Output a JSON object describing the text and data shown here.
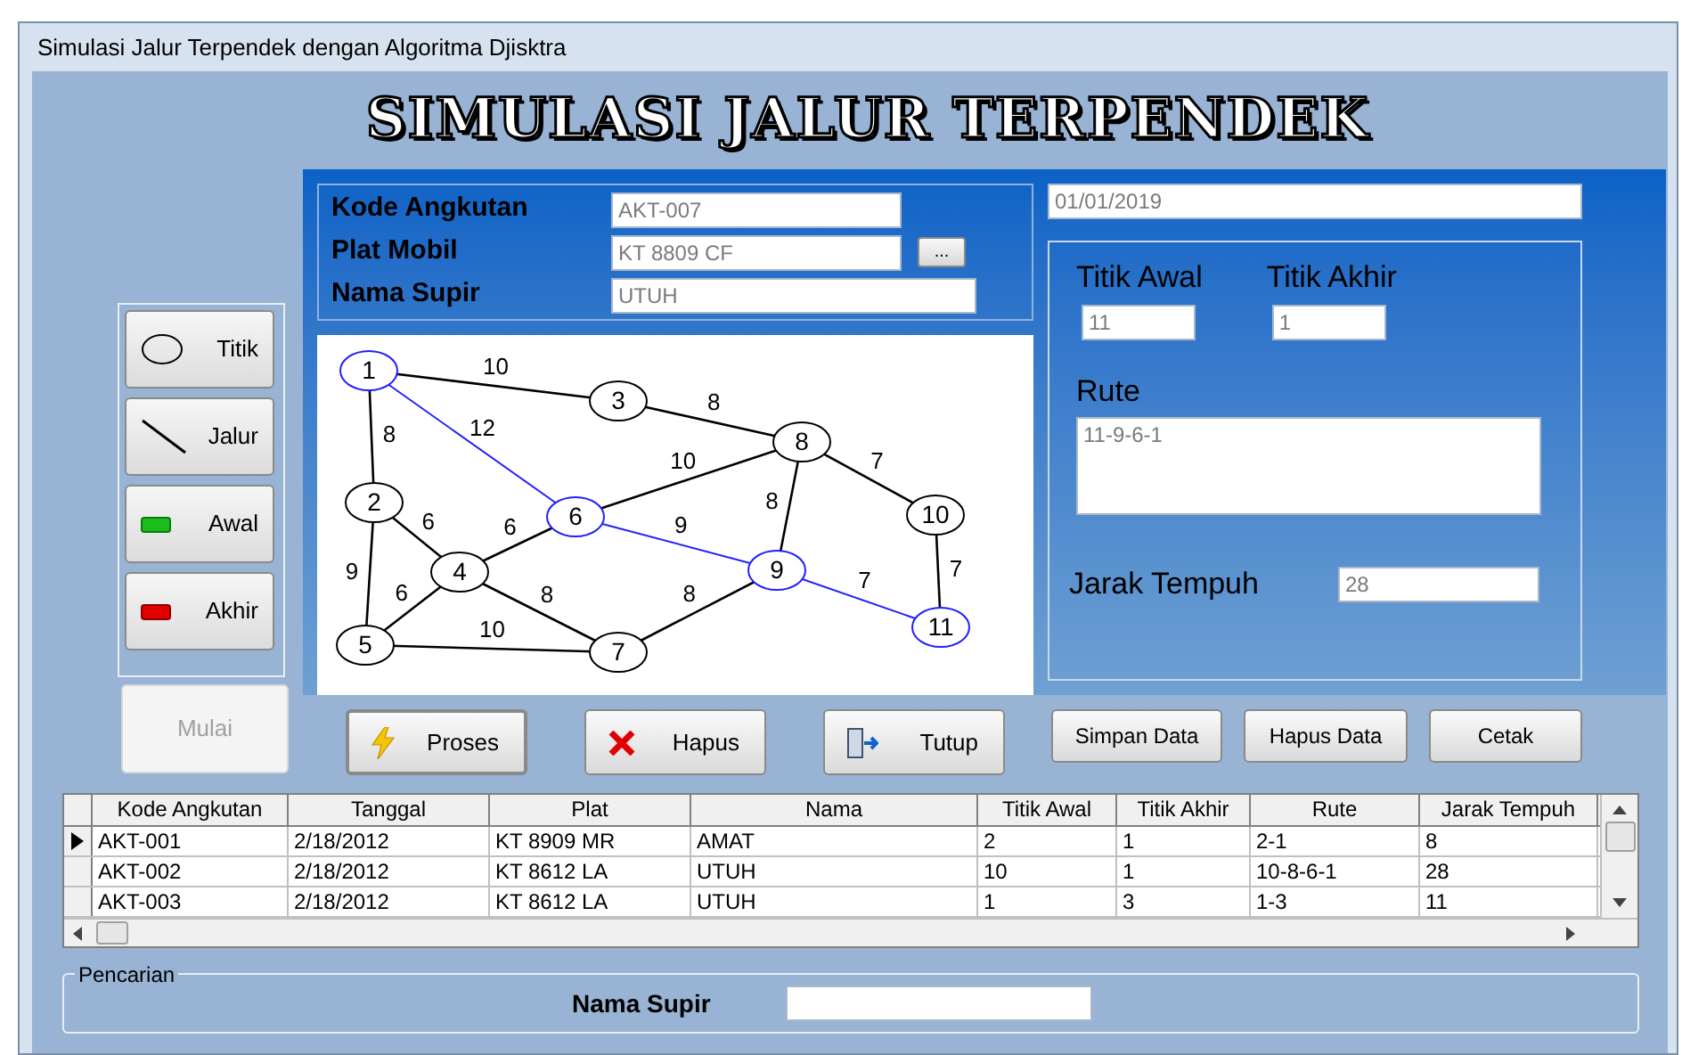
{
  "window": {
    "title": "Simulasi Jalur Terpendek dengan Algoritma Djisktra"
  },
  "heading": "SIMULASI JALUR TERPENDEK",
  "tools": [
    {
      "label": "Titik",
      "kind": "node"
    },
    {
      "label": "Jalur",
      "kind": "edge"
    },
    {
      "label": "Awal",
      "kind": "start"
    },
    {
      "label": "Akhir",
      "kind": "end"
    }
  ],
  "start_button": {
    "label": "Mulai",
    "disabled": true
  },
  "form": {
    "fields": [
      {
        "label": "Kode Angkutan",
        "value": "AKT-007"
      },
      {
        "label": "Plat Mobil",
        "value": "KT 8809 CF",
        "browse": "..."
      },
      {
        "label": "Nama Supir",
        "value": "UTUH"
      }
    ]
  },
  "date": "01/01/2019",
  "graph": {
    "nodes": [
      {
        "label": "1",
        "on_route": true
      },
      {
        "label": "3",
        "on_route": false
      },
      {
        "label": "8",
        "on_route": false
      },
      {
        "label": "2",
        "on_route": false
      },
      {
        "label": "6",
        "on_route": true
      },
      {
        "label": "10",
        "on_route": false
      },
      {
        "label": "4",
        "on_route": false
      },
      {
        "label": "9",
        "on_route": true
      },
      {
        "label": "11",
        "on_route": true
      },
      {
        "label": "5",
        "on_route": false
      },
      {
        "label": "7",
        "on_route": false
      }
    ],
    "edges": [
      {
        "weight": "10",
        "on_route": false
      },
      {
        "weight": "8",
        "on_route": false
      },
      {
        "weight": "12",
        "on_route": true
      },
      {
        "weight": "8",
        "on_route": false
      },
      {
        "weight": "10",
        "on_route": false
      },
      {
        "weight": "8",
        "on_route": false
      },
      {
        "weight": "7",
        "on_route": false
      },
      {
        "weight": "6",
        "on_route": false
      },
      {
        "weight": "9",
        "on_route": false
      },
      {
        "weight": "6",
        "on_route": false
      },
      {
        "weight": "9",
        "on_route": true
      },
      {
        "weight": "7",
        "on_route": true
      },
      {
        "weight": "7",
        "on_route": false
      },
      {
        "weight": "6",
        "on_route": false
      },
      {
        "weight": "8",
        "on_route": false
      },
      {
        "weight": "10",
        "on_route": false
      },
      {
        "weight": "8",
        "on_route": false
      }
    ]
  },
  "result": {
    "start_label": "Titik Awal",
    "start_value": "11",
    "end_label": "Titik Akhir",
    "end_value": "1",
    "route_label": "Rute",
    "route_value": "11-9-6-1",
    "distance_label": "Jarak Tempuh",
    "distance_value": "28"
  },
  "actions": [
    {
      "label": "Proses",
      "kind": "process"
    },
    {
      "label": "Hapus",
      "kind": "delete"
    },
    {
      "label": "Tutup",
      "kind": "exit"
    },
    {
      "label": "Simpan Data",
      "kind": "plain"
    },
    {
      "label": "Hapus Data",
      "kind": "plain"
    },
    {
      "label": "Cetak",
      "kind": "plain"
    }
  ],
  "table": {
    "columns": [
      "Kode Angkutan",
      "Tanggal",
      "Plat",
      "Nama",
      "Titik Awal",
      "Titik Akhir",
      "Rute",
      "Jarak Tempuh"
    ],
    "rows": [
      {
        "selected": true,
        "cells": [
          "AKT-001",
          "2/18/2012",
          "KT 8909 MR",
          "AMAT",
          "2",
          "1",
          "2-1",
          "8"
        ]
      },
      {
        "selected": false,
        "cells": [
          "AKT-002",
          "2/18/2012",
          "KT 8612 LA",
          "UTUH",
          "10",
          "1",
          "10-8-6-1",
          "28"
        ]
      },
      {
        "selected": false,
        "cells": [
          "AKT-003",
          "2/18/2012",
          "KT 8612 LA",
          "UTUH",
          "1",
          "3",
          "1-3",
          "11"
        ]
      }
    ]
  },
  "search": {
    "group_label": "Pencarian",
    "label": "Nama Supir"
  }
}
